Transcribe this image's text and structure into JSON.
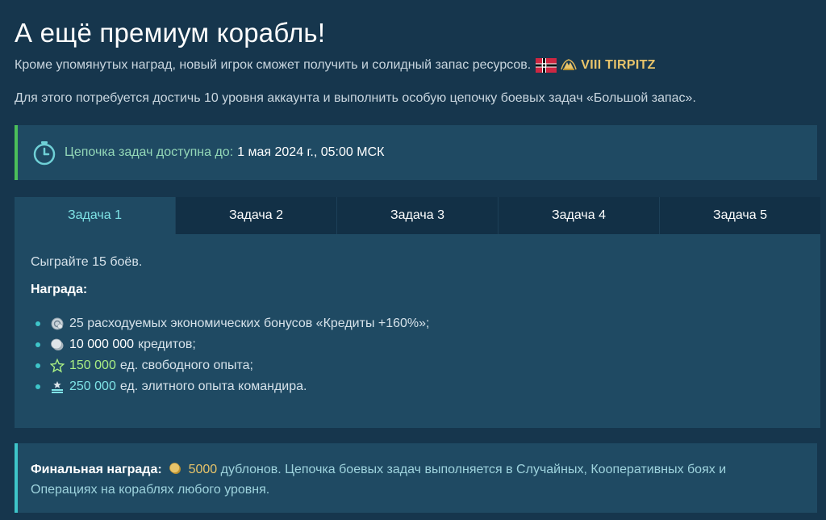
{
  "title": "А ещё премиум корабль!",
  "intro": {
    "line1": "Кроме упомянутых наград, новый игрок сможет получить и солидный запас ресурсов.",
    "ship_name": "VIII TIRPITZ",
    "line2": "Для этого потребуется достичь 10 уровня аккаунта и выполнить особую цепочку боевых задач «Большой запас»."
  },
  "timer": {
    "label": "Цепочка задач доступна до:",
    "value": "1 мая 2024 г., 05:00 МСК"
  },
  "tabs": [
    {
      "label": "Задача 1",
      "active": true
    },
    {
      "label": "Задача 2",
      "active": false
    },
    {
      "label": "Задача 3",
      "active": false
    },
    {
      "label": "Задача 4",
      "active": false
    },
    {
      "label": "Задача 5",
      "active": false
    }
  ],
  "task": {
    "description": "Сыграйте 15 боёв.",
    "reward_heading": "Награда:",
    "rewards": [
      {
        "icon": "economic-bonus-icon",
        "amount": "",
        "text": "25 расходуемых экономических бонусов «Кредиты +160%»;"
      },
      {
        "icon": "credits-icon",
        "amount": "10 000 000",
        "text": "кредитов;"
      },
      {
        "icon": "free-xp-star-icon",
        "amount": "150 000",
        "text": "ед. свободного опыта;"
      },
      {
        "icon": "commander-xp-icon",
        "amount": "250 000",
        "text": "ед. элитного опыта командира."
      }
    ]
  },
  "final": {
    "label": "Финальная награда:",
    "amount": "5000",
    "currency": "дублонов.",
    "text_line1": "Цепочка боевых задач выполняется в Случайных, Кооперативных боях и",
    "text_line2": "Операциях на кораблях любого уровня."
  },
  "colors": {
    "background": "#16364d",
    "panel": "#1f4a63",
    "accent_cyan": "#7fe3e6",
    "accent_green_border": "#4bbf5a",
    "gold": "#e8c46a"
  }
}
